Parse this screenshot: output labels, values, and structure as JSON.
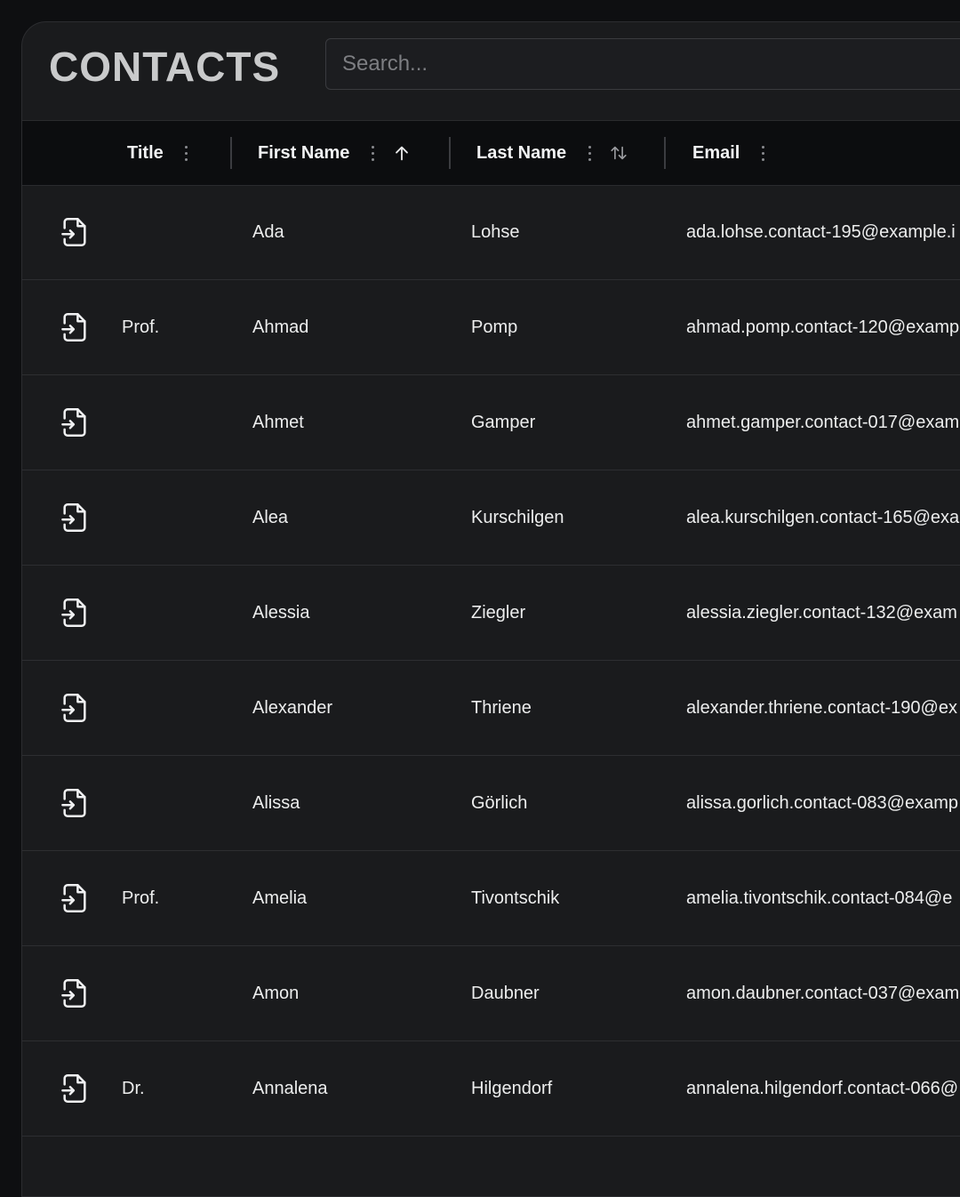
{
  "header": {
    "title": "CONTACTS",
    "search_placeholder": "Search..."
  },
  "columns": [
    {
      "label": "Title"
    },
    {
      "label": "First Name",
      "sort": "ascending"
    },
    {
      "label": "Last Name",
      "sort": "sortable"
    },
    {
      "label": "Email"
    }
  ],
  "icons": {
    "row_action": "file-import-icon",
    "column_menu": "more-vertical-icon",
    "sort_ascending": "arrow-up-icon",
    "sort_toggle": "arrow-up-down-icon"
  },
  "colors": {
    "background": "#1a1b1d",
    "header_background": "#0c0d0f",
    "title": "#c9cacb"
  },
  "rows": [
    {
      "title": "",
      "first_name": "Ada",
      "last_name": "Lohse",
      "email": "ada.lohse.contact-195@example.i"
    },
    {
      "title": "Prof.",
      "first_name": "Ahmad",
      "last_name": "Pomp",
      "email": "ahmad.pomp.contact-120@examp"
    },
    {
      "title": "",
      "first_name": "Ahmet",
      "last_name": "Gamper",
      "email": "ahmet.gamper.contact-017@exam"
    },
    {
      "title": "",
      "first_name": "Alea",
      "last_name": "Kurschilgen",
      "email": "alea.kurschilgen.contact-165@exa"
    },
    {
      "title": "",
      "first_name": "Alessia",
      "last_name": "Ziegler",
      "email": "alessia.ziegler.contact-132@exam"
    },
    {
      "title": "",
      "first_name": "Alexander",
      "last_name": "Thriene",
      "email": "alexander.thriene.contact-190@ex"
    },
    {
      "title": "",
      "first_name": "Alissa",
      "last_name": "Görlich",
      "email": "alissa.gorlich.contact-083@examp"
    },
    {
      "title": "Prof.",
      "first_name": "Amelia",
      "last_name": "Tivontschik",
      "email": "amelia.tivontschik.contact-084@e"
    },
    {
      "title": "",
      "first_name": "Amon",
      "last_name": "Daubner",
      "email": "amon.daubner.contact-037@exam"
    },
    {
      "title": "Dr.",
      "first_name": "Annalena",
      "last_name": "Hilgendorf",
      "email": "annalena.hilgendorf.contact-066@"
    }
  ]
}
